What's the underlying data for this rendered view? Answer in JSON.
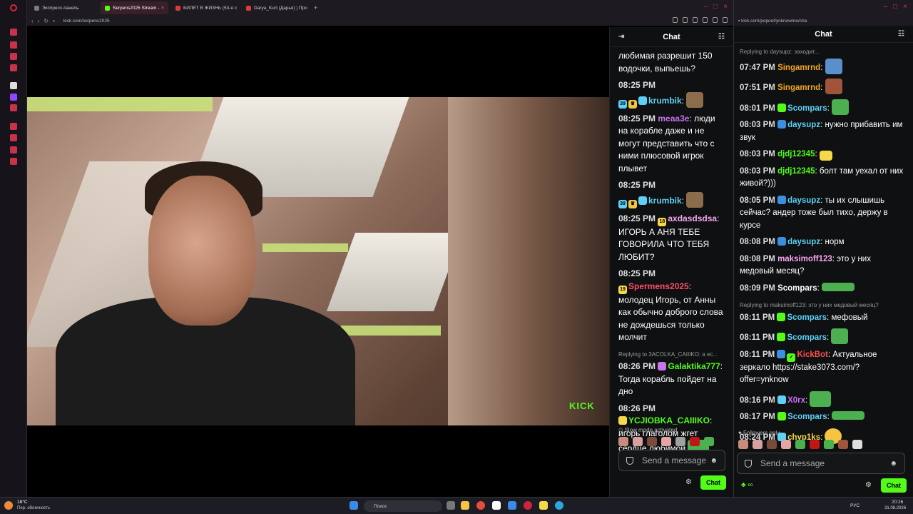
{
  "tabs": [
    {
      "label": "Экспресс-панель",
      "color": "#7a7a7a"
    },
    {
      "label": "Serpens2025 Stream -",
      "color": "#53fc18"
    },
    {
      "label": "БИЛЕТ В ЖИЗНЬ (53-я с",
      "color": "#e03a3a"
    },
    {
      "label": "Darya_Kurt (Дарья) | Про",
      "color": "#e03a3a"
    }
  ],
  "address": {
    "url1": "kick.com/serpens2025",
    "url2": "kick.com/popout/ynknowme/cha"
  },
  "video": {
    "watermark": "KICK"
  },
  "chat1": {
    "title": "Chat",
    "messages": [
      {
        "text": "любимая разрешит 150 водочки, выпьешь?"
      },
      {
        "time": "08:25 PM",
        "user": "krumbik",
        "color": "#5dd0f5",
        "text": ""
      },
      {
        "time": "08:25 PM",
        "user": "meaa3e",
        "color": "#c873f0",
        "text": "люди на корабле даже и не могут представить что с ними плюсовой игрок плывет"
      },
      {
        "time": "08:25 PM",
        "user": "krumbik",
        "color": "#5dd0f5",
        "text": ""
      },
      {
        "time": "08:25 PM",
        "user": "axdasdsdsa",
        "color": "#f7a6f0",
        "text": "ИГОРЬ А АНЯ ТЕБЕ ГОВОРИЛА ЧТО ТЕБЯ ЛЮБИТ?"
      },
      {
        "time": "08:25 PM",
        "user": "Spermens2025",
        "color": "#ff4d6d",
        "text": "молодец Игорь, от Анны как обычно доброго слова не дождешься только молчит"
      },
      {
        "reply": "Replying to 3ACOLKA_CAIIIKO: а ес...",
        "time": "08:26 PM",
        "user": "Galaktika777",
        "color": "#53fc18",
        "text": "Тогда корабль пойдет на дно"
      },
      {
        "time": "08:26 PM",
        "user": "YCJIOBKA_CAIIIKO",
        "color": "#53fc18",
        "text": "игорь глаголом жгет сердце любимой"
      }
    ],
    "slow_mode": "Slow mode activated",
    "input_placeholder": "Send a message",
    "chat_button": "Chat"
  },
  "chat2": {
    "title": "Chat",
    "messages": [
      {
        "reply": "Replying to daysupz: заходит...",
        "time": "",
        "user": "",
        "color": "#fff",
        "text": ""
      },
      {
        "time": "07:47 PM",
        "user": "Singamrnd",
        "color": "#f5a623",
        "text": ""
      },
      {
        "time": "07:51 PM",
        "user": "Singamrnd",
        "color": "#f5a623",
        "text": ""
      },
      {
        "time": "08:01 PM",
        "user": "Scompars",
        "color": "#5dd0f5",
        "text": ""
      },
      {
        "time": "08:03 PM",
        "user": "daysupz",
        "color": "#5dd0f5",
        "text": "нужно прибавить им звук"
      },
      {
        "time": "08:03 PM",
        "user": "djdj12345",
        "color": "#53fc18",
        "text": ""
      },
      {
        "time": "08:03 PM",
        "user": "djdj12345",
        "color": "#53fc18",
        "text": "болт там уехал от них живой?)))"
      },
      {
        "time": "08:05 PM",
        "user": "daysupz",
        "color": "#5dd0f5",
        "text": "ты их слышишь сейчас? андер тоже был тихо, держу в курсе"
      },
      {
        "time": "08:08 PM",
        "user": "daysupz",
        "color": "#5dd0f5",
        "text": "норм"
      },
      {
        "time": "08:08 PM",
        "user": "maksimoff123",
        "color": "#f7a6f0",
        "text": "это у них медовый месяц?"
      },
      {
        "time": "08:09 PM",
        "user": "Scompars",
        "color": "#fff",
        "text": ""
      },
      {
        "reply": "Replying to maksimoff123: это у них медовый месяц?",
        "time": "08:11 PM",
        "user": "Scompars",
        "color": "#5dd0f5",
        "text": "мефовый"
      },
      {
        "time": "08:11 PM",
        "user": "Scompars",
        "color": "#5dd0f5",
        "text": ""
      },
      {
        "time": "08:11 PM",
        "user": "KickBot",
        "color": "#ff4d4d",
        "text": "Актуальное зеркало https://stake3073.com/?offer=ynknow"
      },
      {
        "time": "08:16 PM",
        "user": "X0rx",
        "color": "#c873f0",
        "text": ""
      },
      {
        "time": "08:17 PM",
        "user": "Scompars",
        "color": "#5dd0f5",
        "text": ""
      },
      {
        "time": "08:24 PM",
        "user": "chyp1ks",
        "color": "#f5d94a",
        "text": ""
      }
    ],
    "followers": "Followers only",
    "input_placeholder": "Send a message",
    "chat_button": "Chat"
  },
  "taskbar": {
    "temp": "18°C",
    "weather": "Пер. облачность",
    "search": "Поиск",
    "lang": "РУС",
    "time": "20:26",
    "date": "31.08.2026"
  }
}
